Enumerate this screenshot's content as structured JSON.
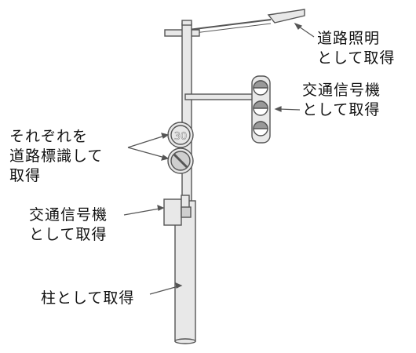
{
  "labels": {
    "street_light": [
      "道路照明",
      "として取得"
    ],
    "traffic_signal_top": [
      "交通信号機",
      "として取得"
    ],
    "road_signs": [
      "それぞれを",
      "道路標識して",
      "取得"
    ],
    "traffic_signal_small": [
      "交通信号機",
      "として取得"
    ],
    "pole": "柱として取得"
  },
  "speed_sign_value": "30",
  "colors": {
    "stroke": "#555555",
    "fill_light": "#e8e8e8",
    "fill_mid": "#cfcfcf",
    "lamp_dark": "#999999",
    "text": "#111111"
  }
}
